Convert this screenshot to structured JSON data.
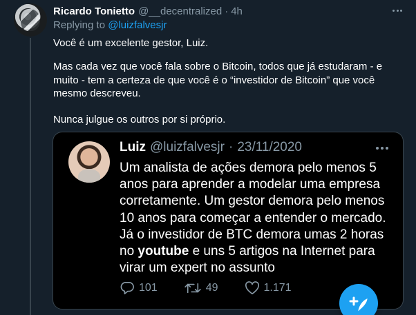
{
  "tweet": {
    "name": "Ricardo Tonietto",
    "handle": "@__decentralized",
    "separator": "·",
    "time": "4h",
    "replying_prefix": "Replying to",
    "replying_to": "@luizfalvesjr",
    "paragraphs": [
      "Você é um excelente gestor, Luiz.",
      "Mas cada vez que você fala sobre o Bitcoin, todos que já estudaram - e muito - tem a certeza de que você é o “investidor de Bitcoin” que você mesmo descreveu.",
      "Nunca julgue os outros por si próprio."
    ]
  },
  "quote": {
    "name": "Luiz",
    "handle": "@luizfalvesjr",
    "separator": "·",
    "date": "23/11/2020",
    "text_before": "Um analista de ações demora pelo menos 5 anos para aprender a modelar uma empresa corretamente. Um gestor demora pelo menos 10 anos para começar a entender o mercado. Já o investidor de BTC demora umas 2 horas no ",
    "text_bold": "youtube",
    "text_after": " e uns 5 artigos na Internet para virar um expert no assunto",
    "replies": "101",
    "retweets": "49",
    "likes": "1.171"
  },
  "icons": {
    "more": "more-horizontal-icon",
    "reply": "reply-icon",
    "retweet": "retweet-icon",
    "like": "heart-icon",
    "compose": "compose-tweet-icon"
  },
  "colors": {
    "background": "#15202b",
    "quote_background": "#000000",
    "accent": "#1da1f2",
    "muted": "#8899a6",
    "border": "#38444d"
  }
}
